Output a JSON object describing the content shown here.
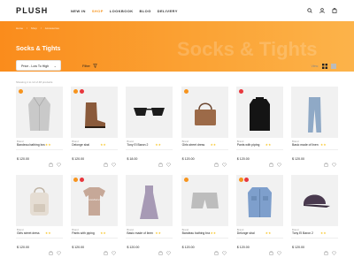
{
  "brand": "PLUSH",
  "nav": [
    "NEW IN",
    "SHOP",
    "LOOKBOOK",
    "BLOG",
    "DELIVERY"
  ],
  "nav_active_index": 1,
  "breadcrumbs": [
    "Home",
    "/",
    "Shop",
    "/",
    "Accessories"
  ],
  "hero": {
    "title": "Socks & Tights",
    "ghost_text": "Socks & Tights"
  },
  "toolbar": {
    "sort_value": "Price - Low To High",
    "filter_label": "Filter",
    "view_label": "View:"
  },
  "results_text": "Showing 1 to 12 of 48 products",
  "colors": {
    "accent": "#f7941d",
    "badge_orange": "#f7941d",
    "badge_red": "#e8373d",
    "star": "#f7c21a"
  },
  "products": [
    {
      "brand": "Brand",
      "name": "Bandeau bathing bra",
      "stars": "★★",
      "price": "$ 120.00",
      "image": "coat",
      "badges": [
        "orange"
      ]
    },
    {
      "brand": "Brand",
      "name": "Delonge sbal",
      "stars": "★★",
      "price": "$ 120.00",
      "image": "boot",
      "badges": [
        "orange",
        "red"
      ]
    },
    {
      "brand": "Brand",
      "name": "Tony El Baron 2",
      "stars": "★★",
      "price": "$ 18.00",
      "image": "sunglasses",
      "badges": []
    },
    {
      "brand": "Brand",
      "name": "Girls street dress",
      "stars": "★★",
      "price": "$ 120.00",
      "image": "bag",
      "badges": [
        "orange"
      ]
    },
    {
      "brand": "Brand",
      "name": "Pants with piping",
      "stars": "★★",
      "price": "$ 120.00",
      "image": "sweater",
      "badges": [
        "red"
      ]
    },
    {
      "brand": "Brand",
      "name": "Basic made of linen",
      "stars": "★★",
      "price": "$ 120.00",
      "image": "jeans",
      "badges": []
    },
    {
      "brand": "Brand",
      "name": "Girls street dress",
      "stars": "★★",
      "price": "$ 120.00",
      "image": "backpack",
      "badges": []
    },
    {
      "brand": "Brand",
      "name": "Pants with piping",
      "stars": "★★",
      "price": "$ 120.00",
      "image": "tshirt",
      "badges": [
        "orange",
        "red"
      ]
    },
    {
      "brand": "Brand",
      "name": "Basic made of linen",
      "stars": "★★",
      "price": "$ 120.00",
      "image": "dress",
      "badges": []
    },
    {
      "brand": "Brand",
      "name": "Bandeau bathing bra",
      "stars": "★★",
      "price": "$ 120.00",
      "image": "shorts",
      "badges": [
        "orange"
      ]
    },
    {
      "brand": "Brand",
      "name": "Delonge sbal",
      "stars": "★★",
      "price": "$ 120.00",
      "image": "jacket",
      "badges": [
        "orange",
        "red"
      ]
    },
    {
      "brand": "Brand",
      "name": "Tony El Baron 2",
      "stars": "★★",
      "price": "$ 120.00",
      "image": "cap",
      "badges": []
    }
  ]
}
